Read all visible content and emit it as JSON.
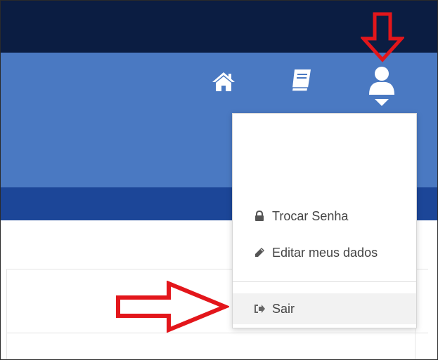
{
  "nav": {
    "icons": [
      {
        "name": "home-icon"
      },
      {
        "name": "book-icon"
      },
      {
        "name": "user-icon"
      }
    ]
  },
  "user_menu": {
    "items": [
      {
        "icon": "lock-icon",
        "label": "Trocar Senha"
      },
      {
        "icon": "pencil-icon",
        "label": "Editar meus dados"
      },
      {
        "icon": "sign-out-icon",
        "label": "Sair"
      }
    ]
  },
  "colors": {
    "topbar": "#0b1d42",
    "navbar": "#4a79c2",
    "subbar": "#1c4698",
    "annotation_arrow": "#e3161b"
  }
}
